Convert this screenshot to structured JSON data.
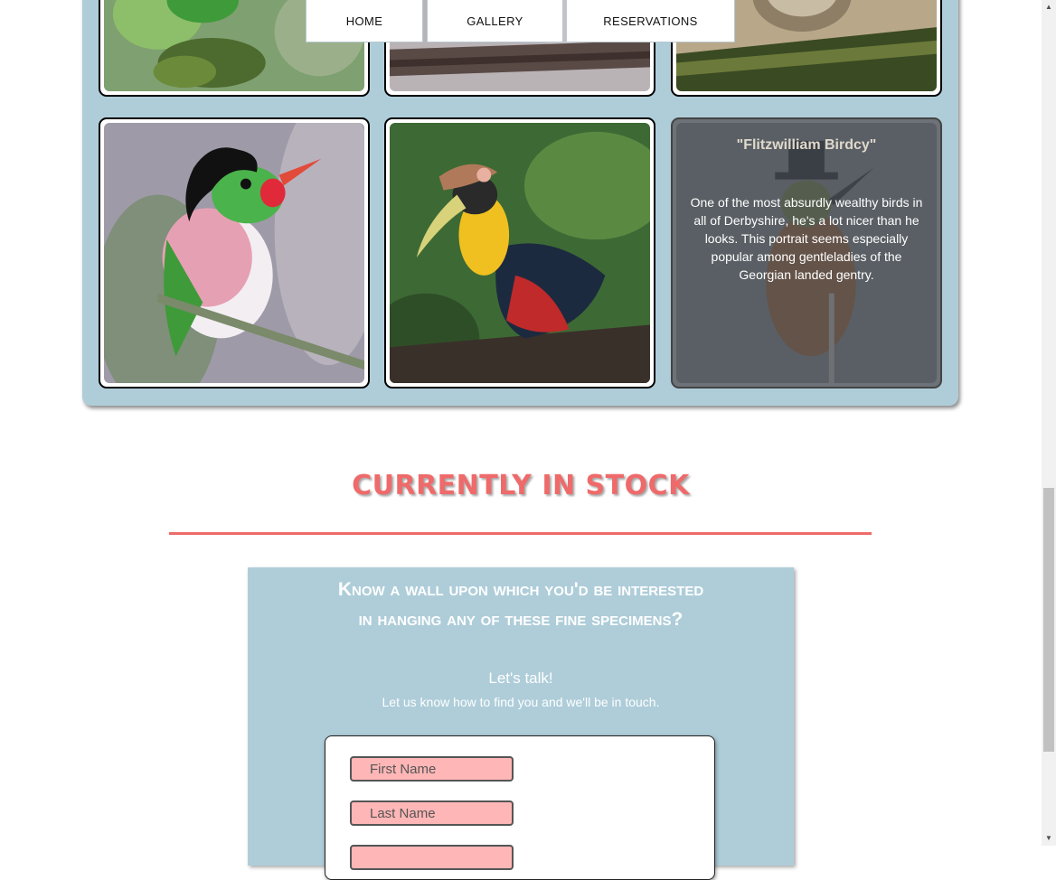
{
  "nav": {
    "items": [
      {
        "label": "HOME"
      },
      {
        "label": "GALLERY"
      },
      {
        "label": "RESERVATIONS"
      }
    ]
  },
  "gallery": {
    "hover_card": {
      "title": "\"Flitzwilliam Birdcy\"",
      "description": "One of the most absurdly wealthy birds in all of Derbyshire, he's a lot nicer than he looks. This portrait seems especially popular among gentleladies of the Georgian landed gentry."
    }
  },
  "stock": {
    "title": "CURRENTLY IN STOCK"
  },
  "contact": {
    "heading": "Know a wall upon which you'd be interested in hanging any of these fine specimens?",
    "talk": "Let's talk!",
    "subtext": "Let us know how to find you and we'll be in touch.",
    "first_name_placeholder": "First Name",
    "last_name_placeholder": "Last Name"
  },
  "colors": {
    "panel": "#aecdd9",
    "accent": "#ef6a6a",
    "field": "#ffb6b6"
  }
}
